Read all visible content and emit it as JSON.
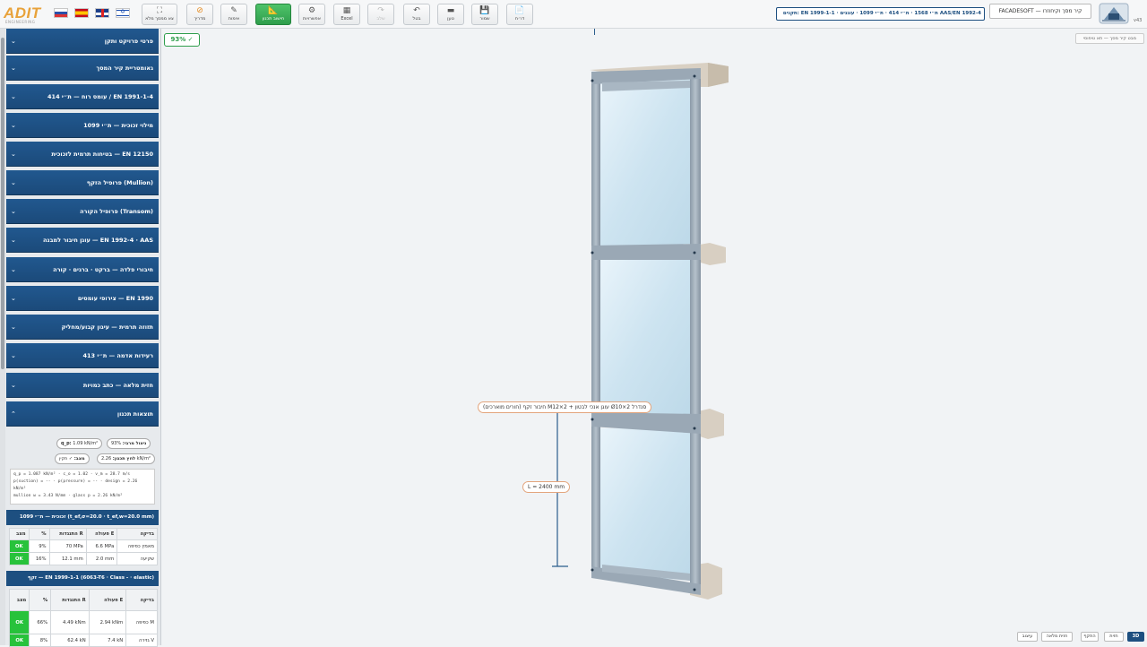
{
  "logo": {
    "text": "ADIT",
    "subtext": "ENGINEERING"
  },
  "flags": [
    "ru-flag",
    "es-flag",
    "gb-flag",
    "il-flag"
  ],
  "toolbar": {
    "fullscreen": "צא ממסך מלא",
    "guide": "מדריך",
    "verify": "אימות",
    "structural_check": "חישוב תכנון",
    "options": "אפשרויות",
    "excel": "Excel",
    "redo": "שלב",
    "undo": "בטל",
    "load": "טען",
    "save": "שמור",
    "report": "דו״ח"
  },
  "standards_box": "תקנים: EN 1999-1-1 · ת״י 1568 · ת״י 414 · ת״י 1099 · עוגנים AAS/EN 1992-4",
  "app_title": "FACADESOFT — קיר מסך וקיחוזרו",
  "version": "v43",
  "panel": {
    "sections": [
      "פרטי פרויקט ותקן",
      "גאומטריית קיר המסך",
      "עומס רוח — ת״י 414 / EN 1991-1-4",
      "מילוי זכוכית — ת״י 1099",
      "בטיחות תרמית לזכוכית — EN 12150",
      "פרופיל הזקף (Mullion)",
      "פרופיל הקורה (Transom)",
      "עוגן חיבור למבנה — EN 1992-4 · AAS",
      "חיבורי פלדה — ברקט · ברגים · קורה",
      "צירופי עומסים — EN 1990",
      "תזוזה תרמית — עיגון קבוע/מחליק",
      "רעידות אדמה — ת״י 413",
      "חזית מלאה — כתב כמויות",
      "תוצאות תכנון"
    ],
    "results": {
      "utilization_label": "ניצול מרבי:",
      "utilization_value": "93%",
      "qp_label": "q_p:",
      "qp_value": "1.09 kN/m²",
      "design_pressure_label": "לחץ תכנון:",
      "design_pressure_value": "2.26 kN/m²",
      "status_label": "מצב:",
      "status_value": "✓ תקין",
      "calc_lines": [
        "q_p = 1.087 kN/m² · c_o = 1.02 · v_m = 28.7 m/s",
        "p(suction) = -- · p(pressure) = -- · design = 2.26",
        "kN/m²",
        "mullion w = 3.43 N/mm · glass p = 2.26 kN/m²"
      ]
    },
    "glass_table": {
      "title": "זכוכית — ת״י 1099 (t_ef,σ=20.0 · t_ef,w=20.0 mm)",
      "headers": [
        "בדיקה",
        "פעולה E",
        "התנגדות R",
        "%",
        "מצב"
      ],
      "rows": [
        [
          "מאמץ כפיפה",
          "6.6 MPa",
          "70 MPa",
          "9%",
          "OK"
        ],
        [
          "שקיעה",
          "2.0 mm",
          "12.1 mm",
          "16%",
          "OK"
        ]
      ]
    },
    "mullion_table": {
      "title": "זקף — EN 1999-1-1 (6063-T6 · Class - · elastic)",
      "headers": [
        "בדיקה",
        "פעולה E",
        "התנגדות R",
        "%",
        "מצב"
      ],
      "rows": [
        [
          "כפיפה M",
          "2.94 kNm",
          "4.49 kNm",
          "66%",
          "OK"
        ],
        [
          "גזירה V",
          "7.4 kN",
          "62.4 kN",
          "8%",
          "OK"
        ]
      ]
    }
  },
  "viewport": {
    "utilization_badge": "93% ✓",
    "view_label": "מבט קיר מסך — תא טיפוסי",
    "callout_connection": "חיבור זקף (חורים מוארכים) M12×עוגן אנכי לבטון + 2 Ø10×סנדרל 2",
    "callout_length": "L = 2400 mm",
    "view_buttons": [
      "עיצוב",
      "חזית מלאה",
      "התקף",
      "חזית",
      "3D"
    ]
  },
  "colors": {
    "accent_blue": "#1d4f80",
    "ok_green": "#27c23b",
    "action_green": "#2f9e4c",
    "logo_orange": "#e8a23a"
  }
}
